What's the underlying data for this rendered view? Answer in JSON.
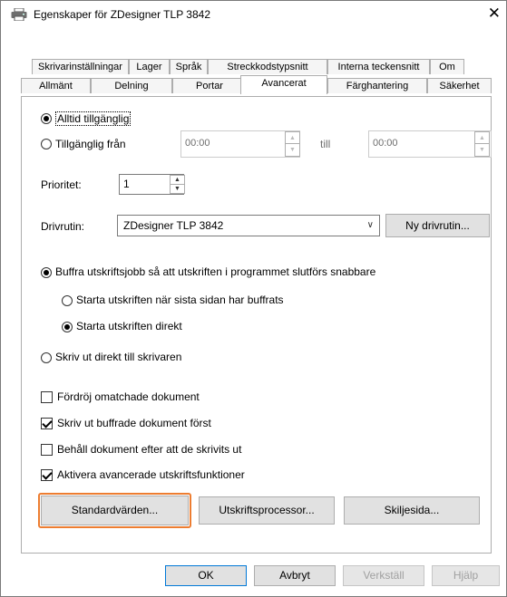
{
  "window": {
    "title": "Egenskaper för ZDesigner TLP 3842",
    "close_glyph": "✕"
  },
  "tabs": {
    "row1": [
      "Skrivarinställningar",
      "Lager",
      "Språk",
      "Streckkodstypsnitt",
      "Interna teckensnitt",
      "Om"
    ],
    "row2": [
      "Allmänt",
      "Delning",
      "Portar",
      "Avancerat",
      "Färghantering",
      "Säkerhet"
    ],
    "active": "Avancerat"
  },
  "availability": {
    "always_label": "Alltid tillgänglig",
    "from_label": "Tillgänglig från",
    "from_value": "00:00",
    "to_label": "till",
    "to_value": "00:00",
    "selected": "always"
  },
  "priority": {
    "label": "Prioritet:",
    "value": "1"
  },
  "driver": {
    "label": "Drivrutin:",
    "value": "ZDesigner TLP 3842",
    "new_button": "Ny drivrutin..."
  },
  "spooling": {
    "buffer_label": "Buffra utskriftsjobb så att utskriften i programmet slutförs snabbare",
    "start_after_last_label": "Starta utskriften när sista sidan har buffrats",
    "start_direct_label": "Starta utskriften direkt",
    "direct_to_printer_label": "Skriv ut direkt till skrivaren"
  },
  "options": [
    {
      "label": "Fördröj omatchade dokument",
      "checked": false
    },
    {
      "label": "Skriv ut buffrade dokument först",
      "checked": true
    },
    {
      "label": "Behåll dokument efter att de skrivits ut",
      "checked": false
    },
    {
      "label": "Aktivera avancerade utskriftsfunktioner",
      "checked": true
    }
  ],
  "panel_buttons": {
    "defaults": "Standardvärden...",
    "processor": "Utskriftsprocessor...",
    "separator": "Skiljesida..."
  },
  "footer": {
    "ok": "OK",
    "cancel": "Avbryt",
    "apply": "Verkställ",
    "help": "Hjälp"
  },
  "colors": {
    "focus_highlight": "#ed7d31",
    "ok_border": "#0078d7"
  },
  "icons": {
    "title": "printer-icon",
    "close": "close-icon"
  }
}
